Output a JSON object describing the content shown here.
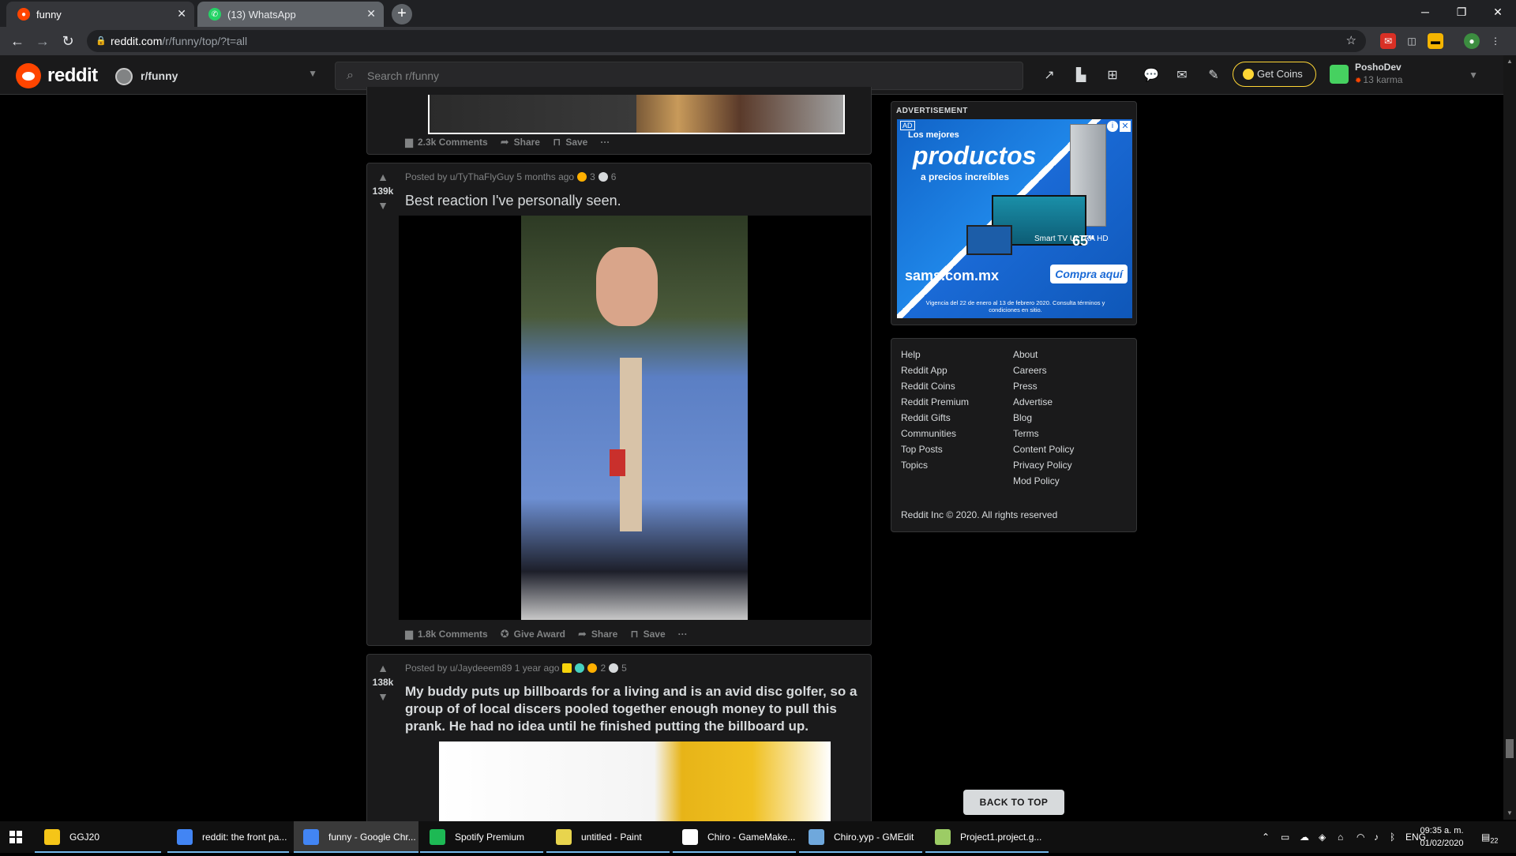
{
  "browser": {
    "tabs": [
      {
        "title": "funny",
        "active": true
      },
      {
        "title": "(13) WhatsApp",
        "active": false
      }
    ],
    "url_host": "reddit.com",
    "url_path": "/r/funny/top/?t=all",
    "new_tab": "+"
  },
  "reddit": {
    "logo_text": "reddit",
    "subreddit": "r/funny",
    "search_placeholder": "Search r/funny",
    "get_coins": "Get Coins",
    "user": {
      "name": "PoshoDev",
      "karma": "13 karma"
    }
  },
  "posts": [
    {
      "comments": "2.3k Comments",
      "share": "Share",
      "save": "Save"
    },
    {
      "score": "139k",
      "posted_by": "Posted by u/TyThaFlyGuy 5 months ago",
      "awards": [
        "3",
        "6"
      ],
      "title": "Best reaction I've personally seen.",
      "comments": "1.8k Comments",
      "give_award": "Give Award",
      "share": "Share",
      "save": "Save"
    },
    {
      "score": "138k",
      "posted_by": "Posted by u/Jaydeeem89 1 year ago",
      "awards": [
        "2",
        "5"
      ],
      "title": "My buddy puts up billboards for a living and is an avid disc golfer, so a group of of local discers pooled together enough money to pull this prank. He had no idea until he finished putting the billboard up."
    }
  ],
  "sidebar": {
    "ad_label": "ADVERTISEMENT",
    "ad": {
      "tag": "AD",
      "line1": "Los mejores",
      "line2": "productos",
      "line3": "a precios increíbles",
      "tv_text": "Smart TV ULTRA HD",
      "tv_size": "65\"",
      "brand": "sams.com.mx",
      "cta": "Compra aquí",
      "fine_print": "Vigencia del 22 de enero al 13 de febrero 2020. Consulta términos y condiciones en sitio."
    },
    "links_left": [
      "Help",
      "Reddit App",
      "Reddit Coins",
      "Reddit Premium",
      "Reddit Gifts",
      "Communities",
      "Top Posts",
      "Topics"
    ],
    "links_right": [
      "About",
      "Careers",
      "Press",
      "Advertise",
      "Blog",
      "Terms",
      "Content Policy",
      "Privacy Policy",
      "Mod Policy"
    ],
    "copyright": "Reddit Inc © 2020. All rights reserved",
    "back_to_top": "BACK TO TOP"
  },
  "taskbar": {
    "items": [
      {
        "label": "GGJ20",
        "color": "#f5c518"
      },
      {
        "label": "reddit: the front pa...",
        "color": "#4285f4"
      },
      {
        "label": "funny - Google Chr...",
        "color": "#4285f4"
      },
      {
        "label": "Spotify Premium",
        "color": "#1db954"
      },
      {
        "label": "untitled - Paint",
        "color": "#e8d44d"
      },
      {
        "label": "Chiro - GameMake...",
        "color": "#ffffff"
      },
      {
        "label": "Chiro.yyp - GMEdit",
        "color": "#6fa8dc"
      },
      {
        "label": "Project1.project.g...",
        "color": "#9ccc65"
      }
    ],
    "lang": "ENG",
    "time": "09:35 a. m.",
    "date": "01/02/2020",
    "notifications": "22"
  },
  "colors": {
    "reddit_orange": "#ff4500",
    "coin_gold": "#ffd635",
    "page_bg": "#000000",
    "card_bg": "#1a1a1b"
  }
}
